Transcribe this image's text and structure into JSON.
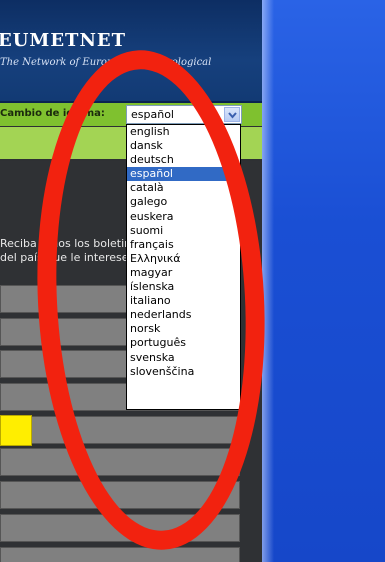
{
  "header": {
    "brand": "EUMETNET",
    "tagline": "The Network of European Meteorological"
  },
  "language_bar": {
    "label": "Cambio de idioma:",
    "selected_value": "español",
    "options": [
      "english",
      "dansk",
      "deutsch",
      "español",
      "català",
      "galego",
      "euskera",
      "suomi",
      "français",
      "Ελληνικά",
      "magyar",
      "íslenska",
      "italiano",
      "nederlands",
      "norsk",
      "português",
      "svenska",
      "slovenščina"
    ],
    "selected_index": 3
  },
  "intro": {
    "line1": "Reciba todos los boletines",
    "line2": "del país que le interese"
  },
  "colors": {
    "header_bg": "#16407d",
    "lang_bar_green": "#7fc12f",
    "strip_green": "#a3d454",
    "selection_blue": "#316ac5",
    "highlight_yellow": "#ffee00",
    "annotation_red": "#f2220f",
    "desktop_blue": "#1b4fd6"
  },
  "icons": {
    "select_arrow": "chevron-down-icon"
  }
}
